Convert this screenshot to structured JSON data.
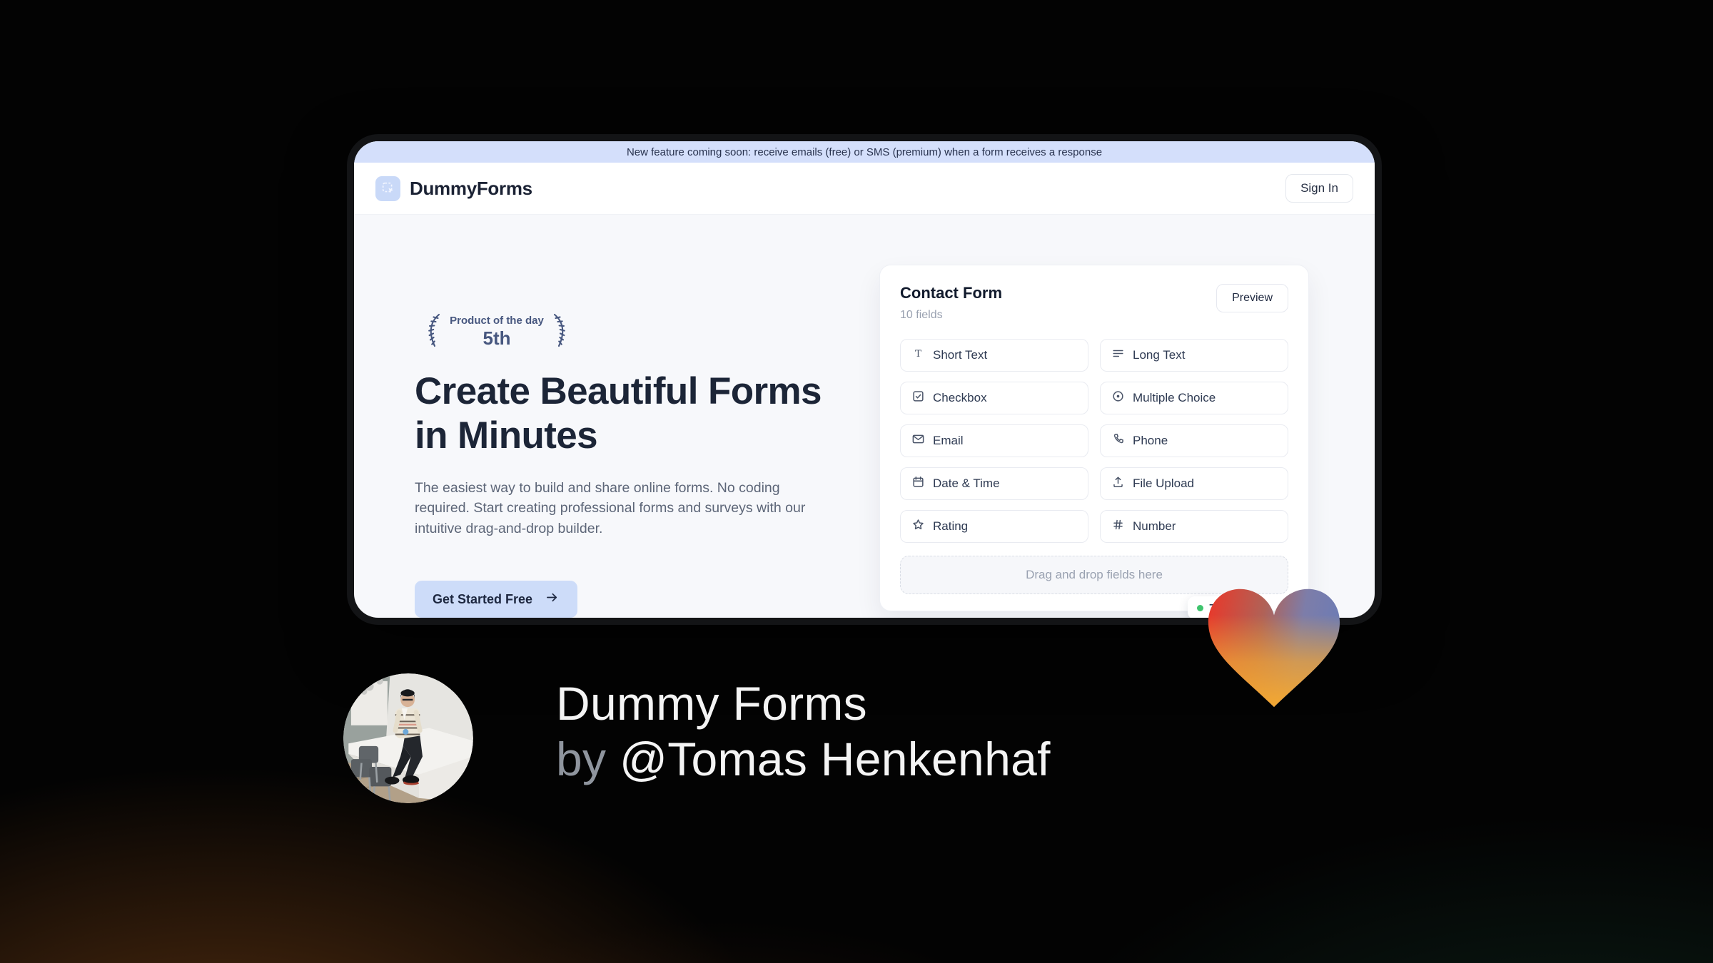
{
  "banner": {
    "text": "New feature coming soon: receive emails (free) or SMS (premium) when a form receives a response"
  },
  "header": {
    "brand": "DummyForms",
    "sign_in_label": "Sign In"
  },
  "hero": {
    "award": {
      "title": "Product of the day",
      "rank": "5th"
    },
    "heading": "Create Beautiful Forms in Minutes",
    "description": "The easiest way to build and share online forms. No coding required. Start creating professional forms and surveys with our intuitive drag-and-drop builder.",
    "cta_label": "Get Started Free"
  },
  "builder_card": {
    "title": "Contact Form",
    "field_count": "10 fields",
    "preview_label": "Preview",
    "fields": [
      {
        "label": "Short Text",
        "icon": "short-text-icon"
      },
      {
        "label": "Long Text",
        "icon": "long-text-icon"
      },
      {
        "label": "Checkbox",
        "icon": "checkbox-icon"
      },
      {
        "label": "Multiple Choice",
        "icon": "radio-icon"
      },
      {
        "label": "Email",
        "icon": "email-icon"
      },
      {
        "label": "Phone",
        "icon": "phone-icon"
      },
      {
        "label": "Date & Time",
        "icon": "calendar-icon"
      },
      {
        "label": "File Upload",
        "icon": "upload-icon"
      },
      {
        "label": "Rating",
        "icon": "star-icon"
      },
      {
        "label": "Number",
        "icon": "hash-icon"
      }
    ],
    "dropzone_text": "Drag and drop fields here",
    "live_counter": {
      "value": "7",
      "dot_color": "#3ec46d"
    }
  },
  "footer": {
    "product_name": "Dummy Forms",
    "byline_prefix": "by",
    "author": "@Tomas Henkenhaf"
  },
  "colors": {
    "banner_bg": "#d4dffb",
    "accent_blue": "#cddcf9",
    "navy": "#1c2537",
    "laurel": "#47577f",
    "heart_red": "#e8392b",
    "heart_orange": "#f2a432",
    "heart_blue": "#6d7cb4"
  }
}
